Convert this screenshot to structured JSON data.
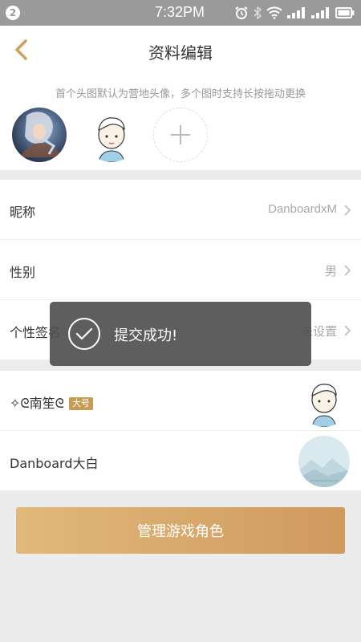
{
  "status_bar": {
    "notification_count": "2",
    "time": "7:32PM"
  },
  "header": {
    "title": "资料编辑",
    "hint": "首个头图默认为营地头像，多个图时支持长按拖动更换"
  },
  "profile_rows": [
    {
      "label": "昵称",
      "value": "DanboardxM"
    },
    {
      "label": "性别",
      "value": "男"
    },
    {
      "label": "个性签名",
      "value": "未设置"
    }
  ],
  "roles": [
    {
      "name": "✧ᘓ南笙ᘓ",
      "badge": "大号"
    },
    {
      "name": "Danboard大白",
      "badge": ""
    }
  ],
  "buttons": {
    "manage_roles": "管理游戏角色"
  },
  "toast": {
    "message": "提交成功!"
  },
  "colors": {
    "accent": "#d39d5c",
    "toast_bg": "#505050",
    "status_bar": "#9a9a9a"
  },
  "icons": {
    "back": "chevron-left-icon",
    "add": "plus-icon",
    "row_chevron": "chevron-right-icon",
    "toast": "check-circle-icon"
  }
}
